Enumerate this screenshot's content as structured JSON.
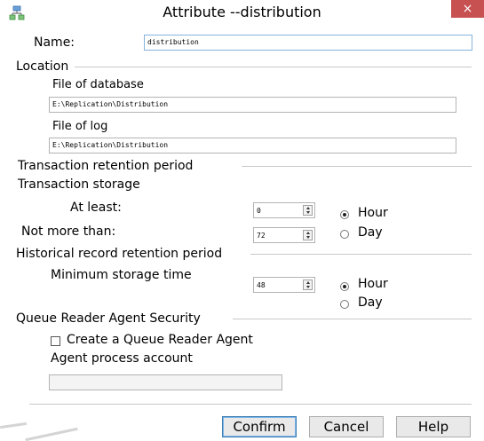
{
  "window": {
    "title": "Attribute --distribution",
    "close_label": "×",
    "icon": "app-tree-icon"
  },
  "name": {
    "label": "Name:",
    "value": "distribution"
  },
  "location": {
    "legend": "Location",
    "database_label": "File of database",
    "database_value": "E:\\Replication\\Distribution",
    "log_label": "File of log",
    "log_value": "E:\\Replication\\Distribution"
  },
  "transaction": {
    "legend": "Transaction retention period",
    "storage_label": "Transaction storage",
    "at_least_label": "At least:",
    "at_least_value": "0",
    "not_more_label": "Not more than:",
    "not_more_value": "72",
    "unit_hour": "Hour",
    "unit_day": "Day",
    "selected_unit": "Hour"
  },
  "history": {
    "legend": "Historical record retention period",
    "min_label": "Minimum storage time",
    "min_value": "48",
    "unit_hour": "Hour",
    "unit_day": "Day",
    "selected_unit": "Hour"
  },
  "queue": {
    "legend": "Queue Reader Agent Security",
    "create_label": "Create a Queue Reader Agent",
    "create_checked": false,
    "account_label": "Agent process account",
    "account_value": ""
  },
  "buttons": {
    "confirm": "Confirm",
    "cancel": "Cancel",
    "help": "Help"
  }
}
